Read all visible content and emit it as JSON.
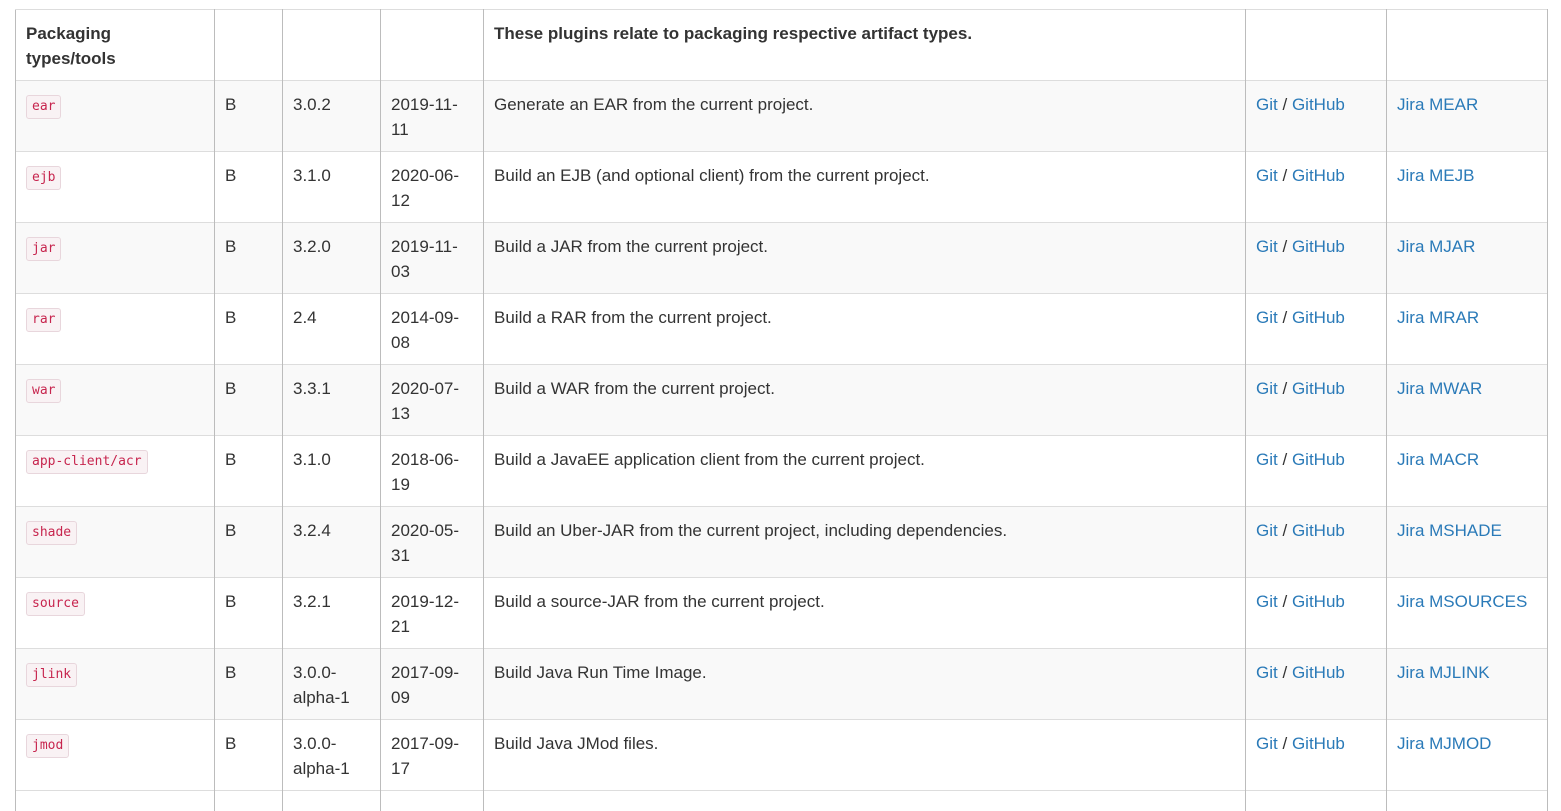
{
  "section": {
    "label": "Packaging types/tools",
    "description": "These plugins relate to packaging respective artifact types."
  },
  "rows": [
    {
      "plugin": "ear",
      "type": "B",
      "version": "3.0.2",
      "date": "2019-11-11",
      "description": "Generate an EAR from the current project.",
      "git": "Git",
      "github": "GitHub",
      "jira": "Jira MEAR"
    },
    {
      "plugin": "ejb",
      "type": "B",
      "version": "3.1.0",
      "date": "2020-06-12",
      "description": "Build an EJB (and optional client) from the current project.",
      "git": "Git",
      "github": "GitHub",
      "jira": "Jira MEJB"
    },
    {
      "plugin": "jar",
      "type": "B",
      "version": "3.2.0",
      "date": "2019-11-03",
      "description": "Build a JAR from the current project.",
      "git": "Git",
      "github": "GitHub",
      "jira": "Jira MJAR"
    },
    {
      "plugin": "rar",
      "type": "B",
      "version": "2.4",
      "date": "2014-09-08",
      "description": "Build a RAR from the current project.",
      "git": "Git",
      "github": "GitHub",
      "jira": "Jira MRAR"
    },
    {
      "plugin": "war",
      "type": "B",
      "version": "3.3.1",
      "date": "2020-07-13",
      "description": "Build a WAR from the current project.",
      "git": "Git",
      "github": "GitHub",
      "jira": "Jira MWAR"
    },
    {
      "plugin": "app-client/acr",
      "type": "B",
      "version": "3.1.0",
      "date": "2018-06-19",
      "description": "Build a JavaEE application client from the current project.",
      "git": "Git",
      "github": "GitHub",
      "jira": "Jira MACR"
    },
    {
      "plugin": "shade",
      "type": "B",
      "version": "3.2.4",
      "date": "2020-05-31",
      "description": "Build an Uber-JAR from the current project, including dependencies.",
      "git": "Git",
      "github": "GitHub",
      "jira": "Jira MSHADE"
    },
    {
      "plugin": "source",
      "type": "B",
      "version": "3.2.1",
      "date": "2019-12-21",
      "description": "Build a source-JAR from the current project.",
      "git": "Git",
      "github": "GitHub",
      "jira": "Jira MSOURCES"
    },
    {
      "plugin": "jlink",
      "type": "B",
      "version": "3.0.0-alpha-1",
      "date": "2017-09-09",
      "description": "Build Java Run Time Image.",
      "git": "Git",
      "github": "GitHub",
      "jira": "Jira MJLINK"
    },
    {
      "plugin": "jmod",
      "type": "B",
      "version": "3.0.0-alpha-1",
      "date": "2017-09-17",
      "description": "Build Java JMod files.",
      "git": "Git",
      "github": "GitHub",
      "jira": "Jira MJMOD"
    }
  ],
  "separator": "/",
  "colors": {
    "link": "#2a7ab8",
    "code": "#c7254e",
    "code_bg": "#f9f2f4",
    "stripe": "#f9f9f9"
  }
}
